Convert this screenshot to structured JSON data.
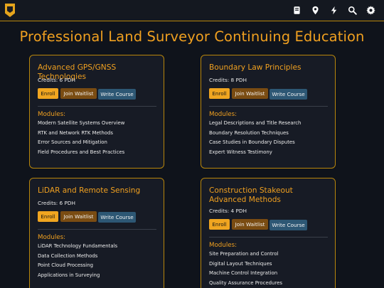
{
  "page": {
    "title": "Professional Land Surveyor Continuing Education"
  },
  "nav": {
    "icons": [
      "book-icon",
      "map-pin-icon",
      "lightning-icon",
      "search-icon",
      "gear-icon"
    ]
  },
  "colors": {
    "accent": "#f0a020",
    "background": "#0f131b",
    "card_bg": "#171b25",
    "card_border": "#b8860b",
    "enroll_button": "#f0a520",
    "waitlist_button": "#7a4c12",
    "write_button": "#2d5774"
  },
  "labels": {
    "enroll": "Enroll",
    "waitlist": "Join Waitlist",
    "write": "Write Course",
    "modules": "Modules:"
  },
  "courses": [
    {
      "title": "Advanced GPS/GNSS Technologies",
      "credits": "Credits: 6 PDH",
      "modules": [
        "Modern Satellite Systems Overview",
        "RTK and Network RTK Methods",
        "Error Sources and Mitigation",
        "Field Procedures and Best Practices"
      ]
    },
    {
      "title": "Boundary Law Principles",
      "credits": "Credits: 8 PDH",
      "modules": [
        "Legal Descriptions and Title Research",
        "Boundary Resolution Techniques",
        "Case Studies in Boundary Disputes",
        "Expert Witness Testimony"
      ]
    },
    {
      "title": "LiDAR and Remote Sensing",
      "credits": "Credits: 6 PDH",
      "modules": [
        "LiDAR Technology Fundamentals",
        "Data Collection Methods",
        "Point Cloud Processing",
        "Applications in Surveying"
      ]
    },
    {
      "title": "Construction Stakeout Advanced Methods",
      "credits": "Credits: 4 PDH",
      "modules": [
        "Site Preparation and Control",
        "Digital Layout Techniques",
        "Machine Control Integration",
        "Quality Assurance Procedures"
      ]
    }
  ]
}
